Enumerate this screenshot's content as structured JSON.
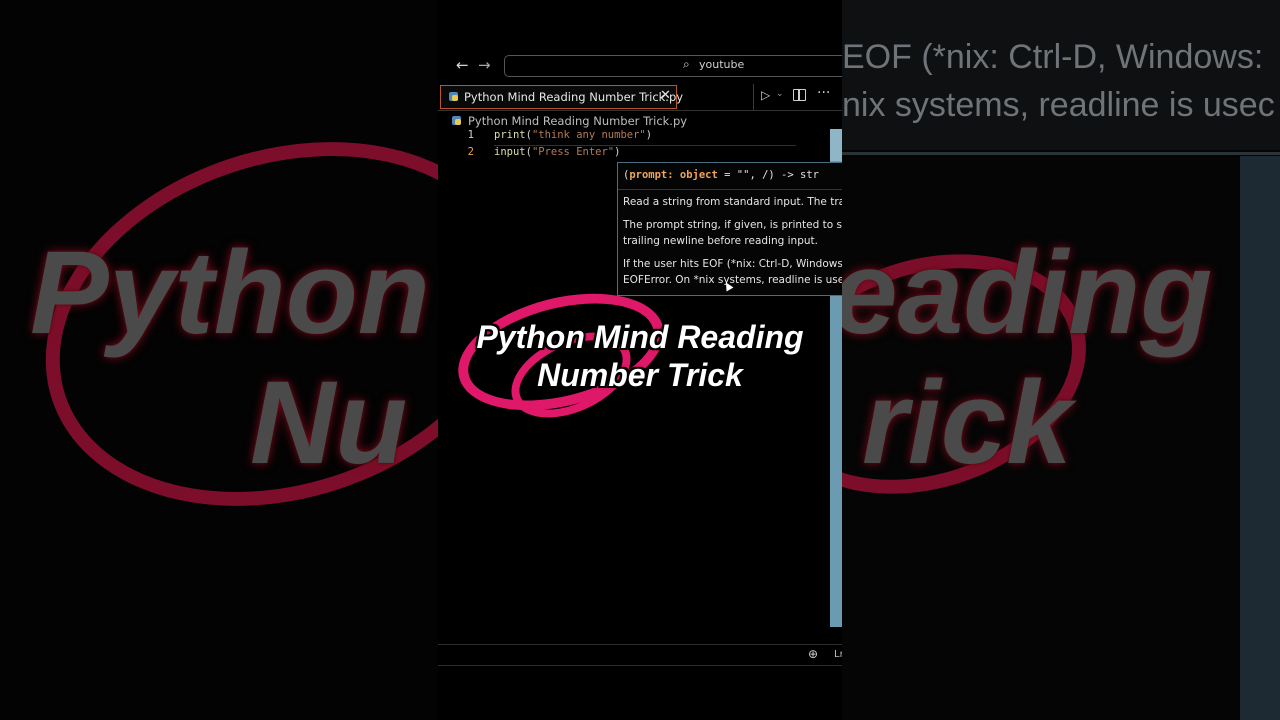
{
  "background": {
    "left_word": "Python",
    "left_word2": "Nu",
    "right_word": "eading",
    "right_word2": "rick",
    "right_line1": "EOF (*nix: Ctrl-D, Windows:",
    "right_line2": "nix systems, readline is usec"
  },
  "window": {
    "search_text": "youtube",
    "back_arrow": "←",
    "forward_arrow": "→",
    "search_icon": "⌕"
  },
  "tab": {
    "label": "Python Mind Reading Number Trick.py",
    "close_glyph": "✕"
  },
  "toolbar": {
    "run_glyph": "▷",
    "run_chevron": "⌄",
    "more_glyph": "···"
  },
  "breadcrumb": {
    "label": "Python Mind Reading Number Trick.py"
  },
  "code": {
    "lines": [
      {
        "number": "1",
        "fn": "print",
        "open": "(",
        "str": "\"think any number\"",
        "close": ")"
      },
      {
        "number": "2",
        "fn": "input",
        "open": "(",
        "str": "\"Press Enter\"",
        "close": ")"
      }
    ]
  },
  "hover": {
    "sig_open": "(",
    "sig_param": "prompt: object",
    "sig_rest": " = \"\", /) -> str",
    "doc_line1": "Read a string from standard input. The tra",
    "doc_line2": "The prompt string, if given, is printed to st",
    "doc_line3": "trailing newline before reading input.",
    "doc_line4": "If the user hits EOF (*nix: Ctrl-D, Windows:",
    "doc_line5": "EOFError. On *nix systems, readline is usec"
  },
  "caption": {
    "line1": "Python Mind Reading",
    "line2": "Number Trick"
  },
  "statusbar": {
    "zoom_icon": "⊕",
    "ln_label": "Lr"
  },
  "colors": {
    "accent_orange": "#b5562f",
    "caption_pink": "#e0186a",
    "minimap": "#6b9bb0"
  }
}
